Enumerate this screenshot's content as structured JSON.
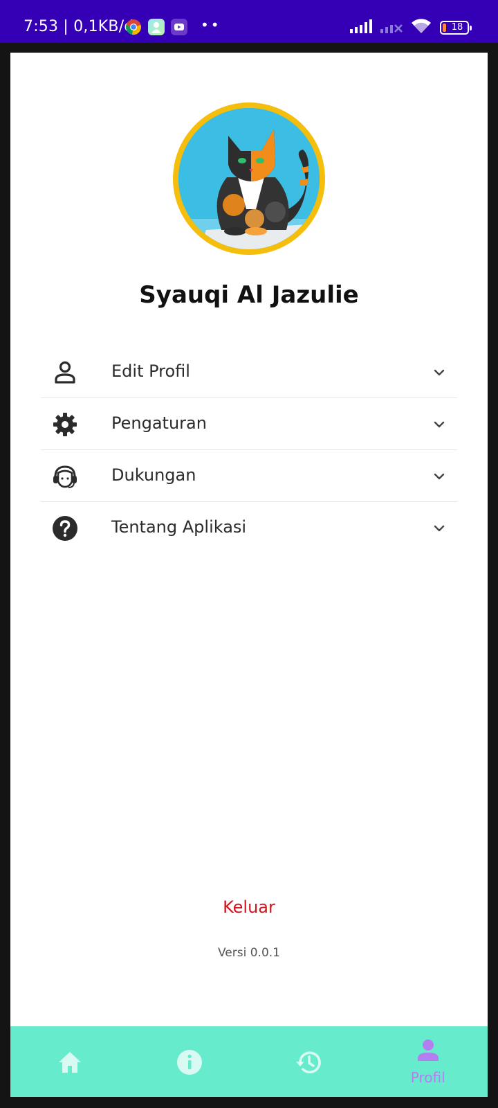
{
  "status_bar": {
    "time": "7:53 | 0,1KB/d",
    "dots": "••",
    "battery_level": "18",
    "app_icons": [
      "chrome-icon",
      "photo-app-icon",
      "youtube-icon"
    ]
  },
  "profile": {
    "name": "Syauqi Al Jazulie",
    "avatar_icon": "cat-avatar-icon"
  },
  "menu": {
    "items": [
      {
        "label": "Edit Profil",
        "icon": "person-icon"
      },
      {
        "label": "Pengaturan",
        "icon": "gear-icon"
      },
      {
        "label": "Dukungan",
        "icon": "headset-icon"
      },
      {
        "label": "Tentang Aplikasi",
        "icon": "help-icon"
      }
    ]
  },
  "logout_label": "Keluar",
  "version": "Versi 0.0.1",
  "bottom_nav": {
    "items": [
      {
        "icon": "home-icon",
        "label": ""
      },
      {
        "icon": "info-icon",
        "label": ""
      },
      {
        "icon": "history-icon",
        "label": ""
      },
      {
        "icon": "profile-icon",
        "label": "Profil"
      }
    ],
    "active": "Profil"
  },
  "colors": {
    "status_bar": "#3500b5",
    "nav_background": "#66ebcc",
    "nav_active": "#b57ef0",
    "logout": "#d0161d",
    "avatar_ring": "#f5bd0c"
  }
}
